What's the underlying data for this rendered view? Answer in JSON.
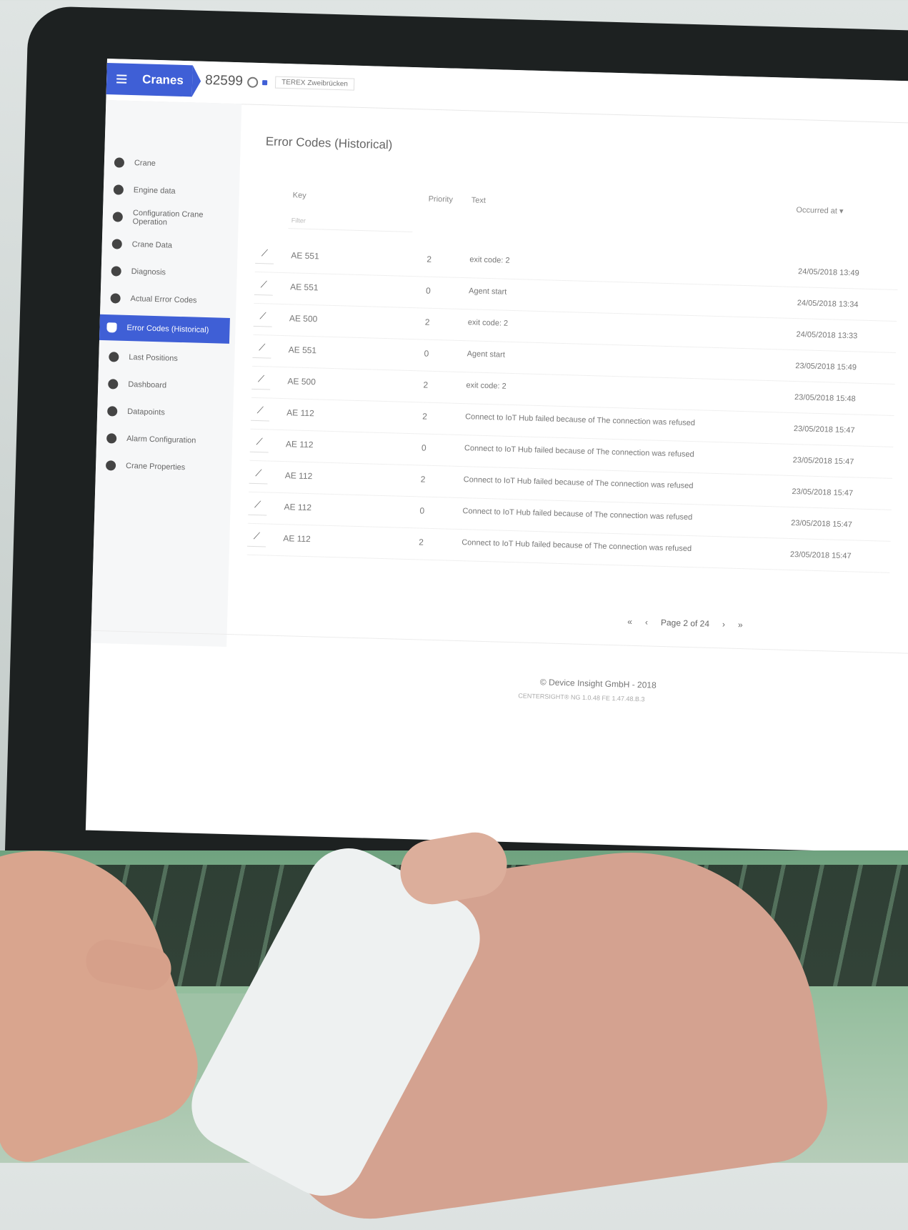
{
  "header": {
    "app_title": "Cranes",
    "crane_id": "82599",
    "crane_tag": "TEREX Zweibrücken"
  },
  "sidebar": {
    "items": [
      {
        "label": "Crane",
        "icon": "crane-icon"
      },
      {
        "label": "Engine data",
        "icon": "engine-icon"
      },
      {
        "label": "Configuration Crane Operation",
        "icon": "config-icon"
      },
      {
        "label": "Crane Data",
        "icon": "data-icon"
      },
      {
        "label": "Diagnosis",
        "icon": "diagnosis-icon"
      },
      {
        "label": "Actual Error Codes",
        "icon": "bell-icon"
      },
      {
        "label": "Error Codes (Historical)",
        "icon": "bell-icon",
        "active": true
      },
      {
        "label": "Last Positions",
        "icon": "location-pin-icon"
      },
      {
        "label": "Dashboard",
        "icon": "dashboard-icon"
      },
      {
        "label": "Datapoints",
        "icon": "datapoints-icon"
      },
      {
        "label": "Alarm Configuration",
        "icon": "alarm-icon"
      },
      {
        "label": "Crane Properties",
        "icon": "properties-icon"
      }
    ]
  },
  "main": {
    "title": "Error Codes (Historical)",
    "columns": {
      "key": "Key",
      "priority": "Priority",
      "text": "Text",
      "occurred": "Occurred at ▾"
    },
    "filter_placeholder": "Filter",
    "rows": [
      {
        "key": "AE 551",
        "priority": "2",
        "text": "exit code: 2",
        "date": "24/05/2018 13:49"
      },
      {
        "key": "AE 551",
        "priority": "0",
        "text": "Agent start",
        "date": "24/05/2018 13:34"
      },
      {
        "key": "AE 500",
        "priority": "2",
        "text": "exit code: 2",
        "date": "24/05/2018 13:33"
      },
      {
        "key": "AE 551",
        "priority": "0",
        "text": "Agent start",
        "date": "23/05/2018 15:49"
      },
      {
        "key": "AE 500",
        "priority": "2",
        "text": "exit code: 2",
        "date": "23/05/2018 15:48"
      },
      {
        "key": "AE 112",
        "priority": "2",
        "text": "Connect to IoT Hub failed because of The connection was refused",
        "date": "23/05/2018 15:47"
      },
      {
        "key": "AE 112",
        "priority": "0",
        "text": "Connect to IoT Hub failed because of The connection was refused",
        "date": "23/05/2018 15:47"
      },
      {
        "key": "AE 112",
        "priority": "2",
        "text": "Connect to IoT Hub failed because of The connection was refused",
        "date": "23/05/2018 15:47"
      },
      {
        "key": "AE 112",
        "priority": "0",
        "text": "Connect to IoT Hub failed because of The connection was refused",
        "date": "23/05/2018 15:47"
      },
      {
        "key": "AE 112",
        "priority": "2",
        "text": "Connect to IoT Hub failed because of The connection was refused",
        "date": "23/05/2018 15:47"
      }
    ],
    "pager": {
      "first": "«",
      "prev": "‹",
      "label": "Page 2 of 24",
      "next": "›",
      "last": "»"
    }
  },
  "footer": {
    "copyright": "© Device Insight GmbH - 2018",
    "version": "CENTERSIGHT® NG 1.0.48 FE 1.47.48.B.3"
  },
  "colors": {
    "accent": "#3f5fd6"
  }
}
